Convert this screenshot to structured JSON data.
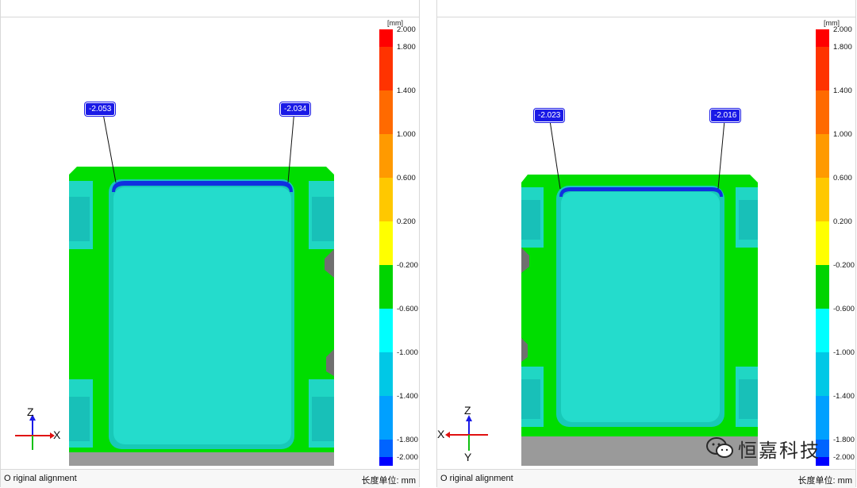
{
  "left": {
    "status_text": "O riginal alignment",
    "unit_text": "长度单位: mm",
    "callouts": [
      "-2.053",
      "-2.034"
    ],
    "axes": {
      "top": "Z",
      "right": "X"
    }
  },
  "right": {
    "status_text": "O riginal alignment",
    "unit_text": "长度单位: mm",
    "callouts": [
      "-2.023",
      "-2.016"
    ],
    "axes": {
      "top": "Z",
      "left": "X",
      "bottom": "Y"
    }
  },
  "scale": {
    "unit": "[mm]",
    "ticks": [
      "2.000",
      "1.800",
      "1.400",
      "1.000",
      "0.600",
      "0.200",
      "-0.200",
      "-0.600",
      "-1.000",
      "-1.400",
      "-1.800",
      "-2.000"
    ],
    "colors": [
      "#ff0000",
      "#ff3300",
      "#ff6a00",
      "#ff9a00",
      "#ffc800",
      "#ffff00",
      "#00d400",
      "#00ffff",
      "#00c8e6",
      "#00a0ff",
      "#0064ff",
      "#0000ff"
    ]
  },
  "watermark": {
    "text": "恒嘉科技",
    "icon": "wechat-icon"
  },
  "colors": {
    "nominal": "#00dd00",
    "pocket": "#20d6c4",
    "deep": "#1030e0",
    "gray": "#9a9a9a"
  }
}
